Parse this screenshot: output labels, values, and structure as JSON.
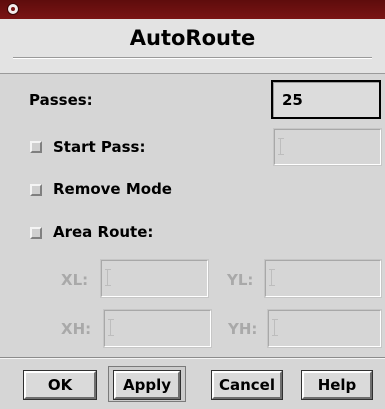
{
  "window": {
    "title": "AutoRoute",
    "icon": "window-menu-icon"
  },
  "form": {
    "passes_label": "Passes:",
    "passes_value": "25",
    "start_pass_label": "Start Pass:",
    "start_pass_value": "",
    "remove_mode_label": "Remove Mode",
    "area_route_label": "Area Route:",
    "xl_label": "XL:",
    "yl_label": "YL:",
    "xh_label": "XH:",
    "yh_label": "YH:",
    "xl_value": "",
    "yl_value": "",
    "xh_value": "",
    "yh_value": ""
  },
  "buttons": {
    "ok": "OK",
    "apply": "Apply",
    "cancel": "Cancel",
    "help": "Help"
  },
  "colors": {
    "titlebar": "#6a0f0f",
    "background": "#d6d6d6",
    "disabled_text": "#a9a9a9"
  }
}
